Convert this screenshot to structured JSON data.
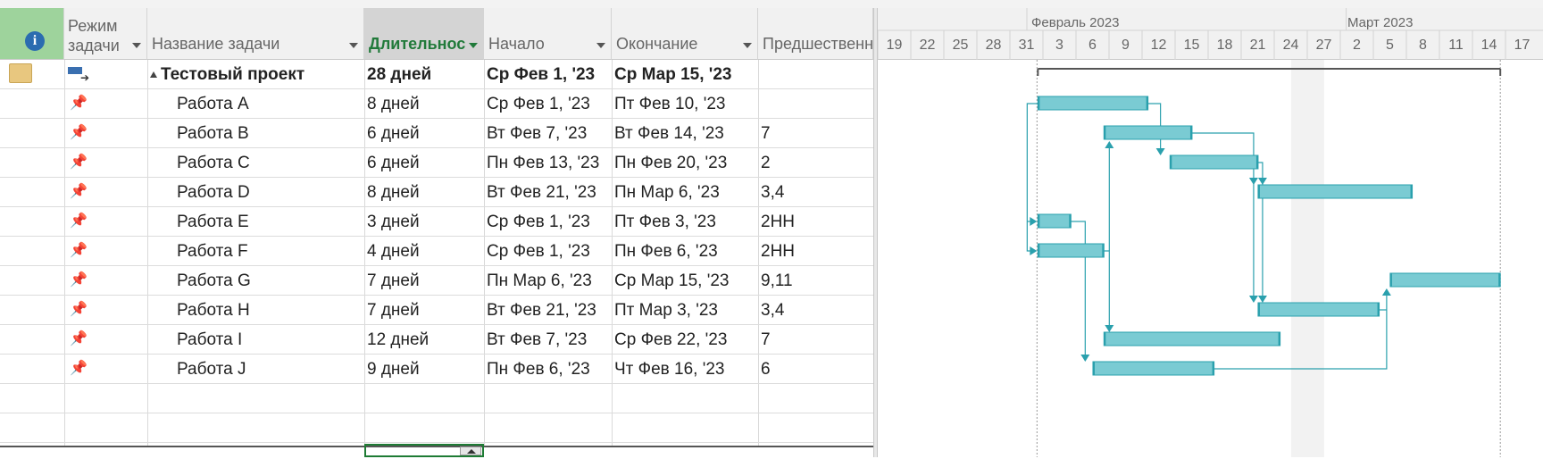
{
  "columns": {
    "info_icon": "i",
    "mode_line1": "Режим",
    "mode_line2": "задачи",
    "name": "Название задачи",
    "duration": "Длительнос",
    "start": "Начало",
    "finish": "Окончание",
    "predecessors": "Предшественни"
  },
  "tasks": [
    {
      "name": "Тестовый проект",
      "duration": "28 дней",
      "start": "Ср Фев 1, '23",
      "finish": "Ср Мар 15, '23",
      "pred": "",
      "summary": true
    },
    {
      "name": "Работа A",
      "duration": "8 дней",
      "start": "Ср Фев 1, '23",
      "finish": "Пт Фев 10, '23",
      "pred": ""
    },
    {
      "name": "Работа B",
      "duration": "6 дней",
      "start": "Вт Фев 7, '23",
      "finish": "Вт Фев 14, '23",
      "pred": "7"
    },
    {
      "name": "Работа C",
      "duration": "6 дней",
      "start": "Пн Фев 13, '23",
      "finish": "Пн Фев 20, '23",
      "pred": "2"
    },
    {
      "name": "Работа D",
      "duration": "8 дней",
      "start": "Вт Фев 21, '23",
      "finish": "Пн Мар 6, '23",
      "pred": "3,4"
    },
    {
      "name": "Работа E",
      "duration": "3 дней",
      "start": "Ср Фев 1, '23",
      "finish": "Пт Фев 3, '23",
      "pred": "2НН"
    },
    {
      "name": "Работа F",
      "duration": "4 дней",
      "start": "Ср Фев 1, '23",
      "finish": "Пн Фев 6, '23",
      "pred": "2НН"
    },
    {
      "name": "Работа G",
      "duration": "7 дней",
      "start": "Пн Мар 6, '23",
      "finish": "Ср Мар 15, '23",
      "pred": "9,11"
    },
    {
      "name": "Работа H",
      "duration": "7 дней",
      "start": "Вт Фев 21, '23",
      "finish": "Пт Мар 3, '23",
      "pred": "3,4"
    },
    {
      "name": "Работа I",
      "duration": "12 дней",
      "start": "Вт Фев 7, '23",
      "finish": "Ср Фев 22, '23",
      "pred": "7"
    },
    {
      "name": "Работа J",
      "duration": "9 дней",
      "start": "Пн Фев 6, '23",
      "finish": "Чт Фев 16, '23",
      "pred": "6"
    }
  ],
  "timescale": {
    "months": [
      "Февраль 2023",
      "Март 2023"
    ],
    "days": [
      "19",
      "22",
      "25",
      "28",
      "31",
      "3",
      "6",
      "9",
      "12",
      "15",
      "18",
      "21",
      "24",
      "27",
      "2",
      "5",
      "8",
      "11",
      "14",
      "17"
    ]
  },
  "colors": {
    "bar": "#7acbd3",
    "bar_border": "#2aa0ad",
    "link": "#2aa0ad",
    "accent": "#217a3a"
  }
}
